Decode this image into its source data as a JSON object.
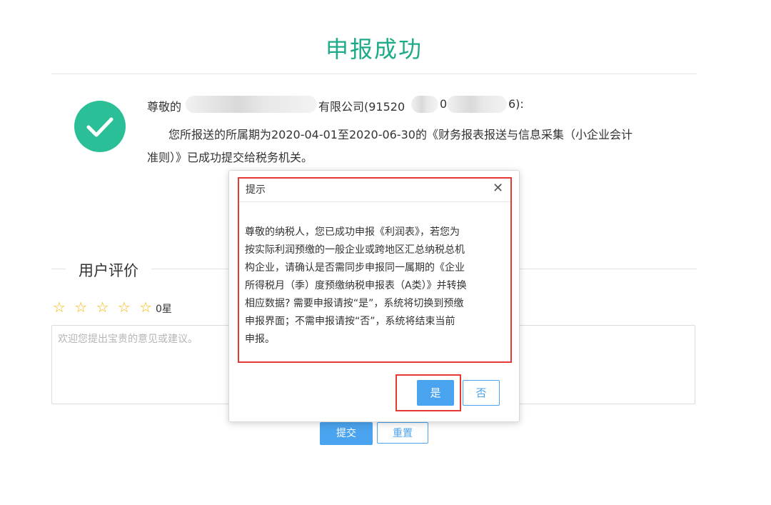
{
  "page": {
    "title": "申报成功"
  },
  "message": {
    "line1_prefix": "尊敬的",
    "line1_company_suffix": "有限公司(91520",
    "line1_mid": "0",
    "line1_end": "6):",
    "line2": "您所报送的所属期为2020-04-01至2020-06-30的《财务报表报送与信息采集（小企业会计",
    "line3": "准则）》已成功提交给税务机关。"
  },
  "evaluation": {
    "title": "用户评价",
    "stars": "☆ ☆ ☆ ☆ ☆",
    "score": "0星",
    "placeholder": "欢迎您提出宝贵的意见或建议。",
    "submit_label": "提交",
    "reset_label": "重置"
  },
  "dialog": {
    "title": "提示",
    "close_glyph": "✕",
    "lines": [
      "尊敬的纳税人，您已成功申报《利润表》，若您为",
      "按实际利润预缴的一般企业或跨地区汇总纳税总机",
      "构企业，请确认是否需同步申报同一属期的《企业",
      "所得税月（季）度预缴纳税申报表（A类）》并转换",
      "相应数据? 需要申报请按“是”，系统将切换到预缴",
      "申报界面；不需申报请按“否”，系统将结束当前",
      "申报。"
    ],
    "yes_label": "是",
    "no_label": "否"
  },
  "colors": {
    "accent_green": "#1fab89",
    "check_green": "#2bbf97",
    "button_blue": "#4aa3ee",
    "highlight_red": "#e53935",
    "star_orange": "#f7b500"
  },
  "icons": {
    "success": "check-circle-icon",
    "close": "close-icon",
    "star": "star-outline-icon"
  }
}
